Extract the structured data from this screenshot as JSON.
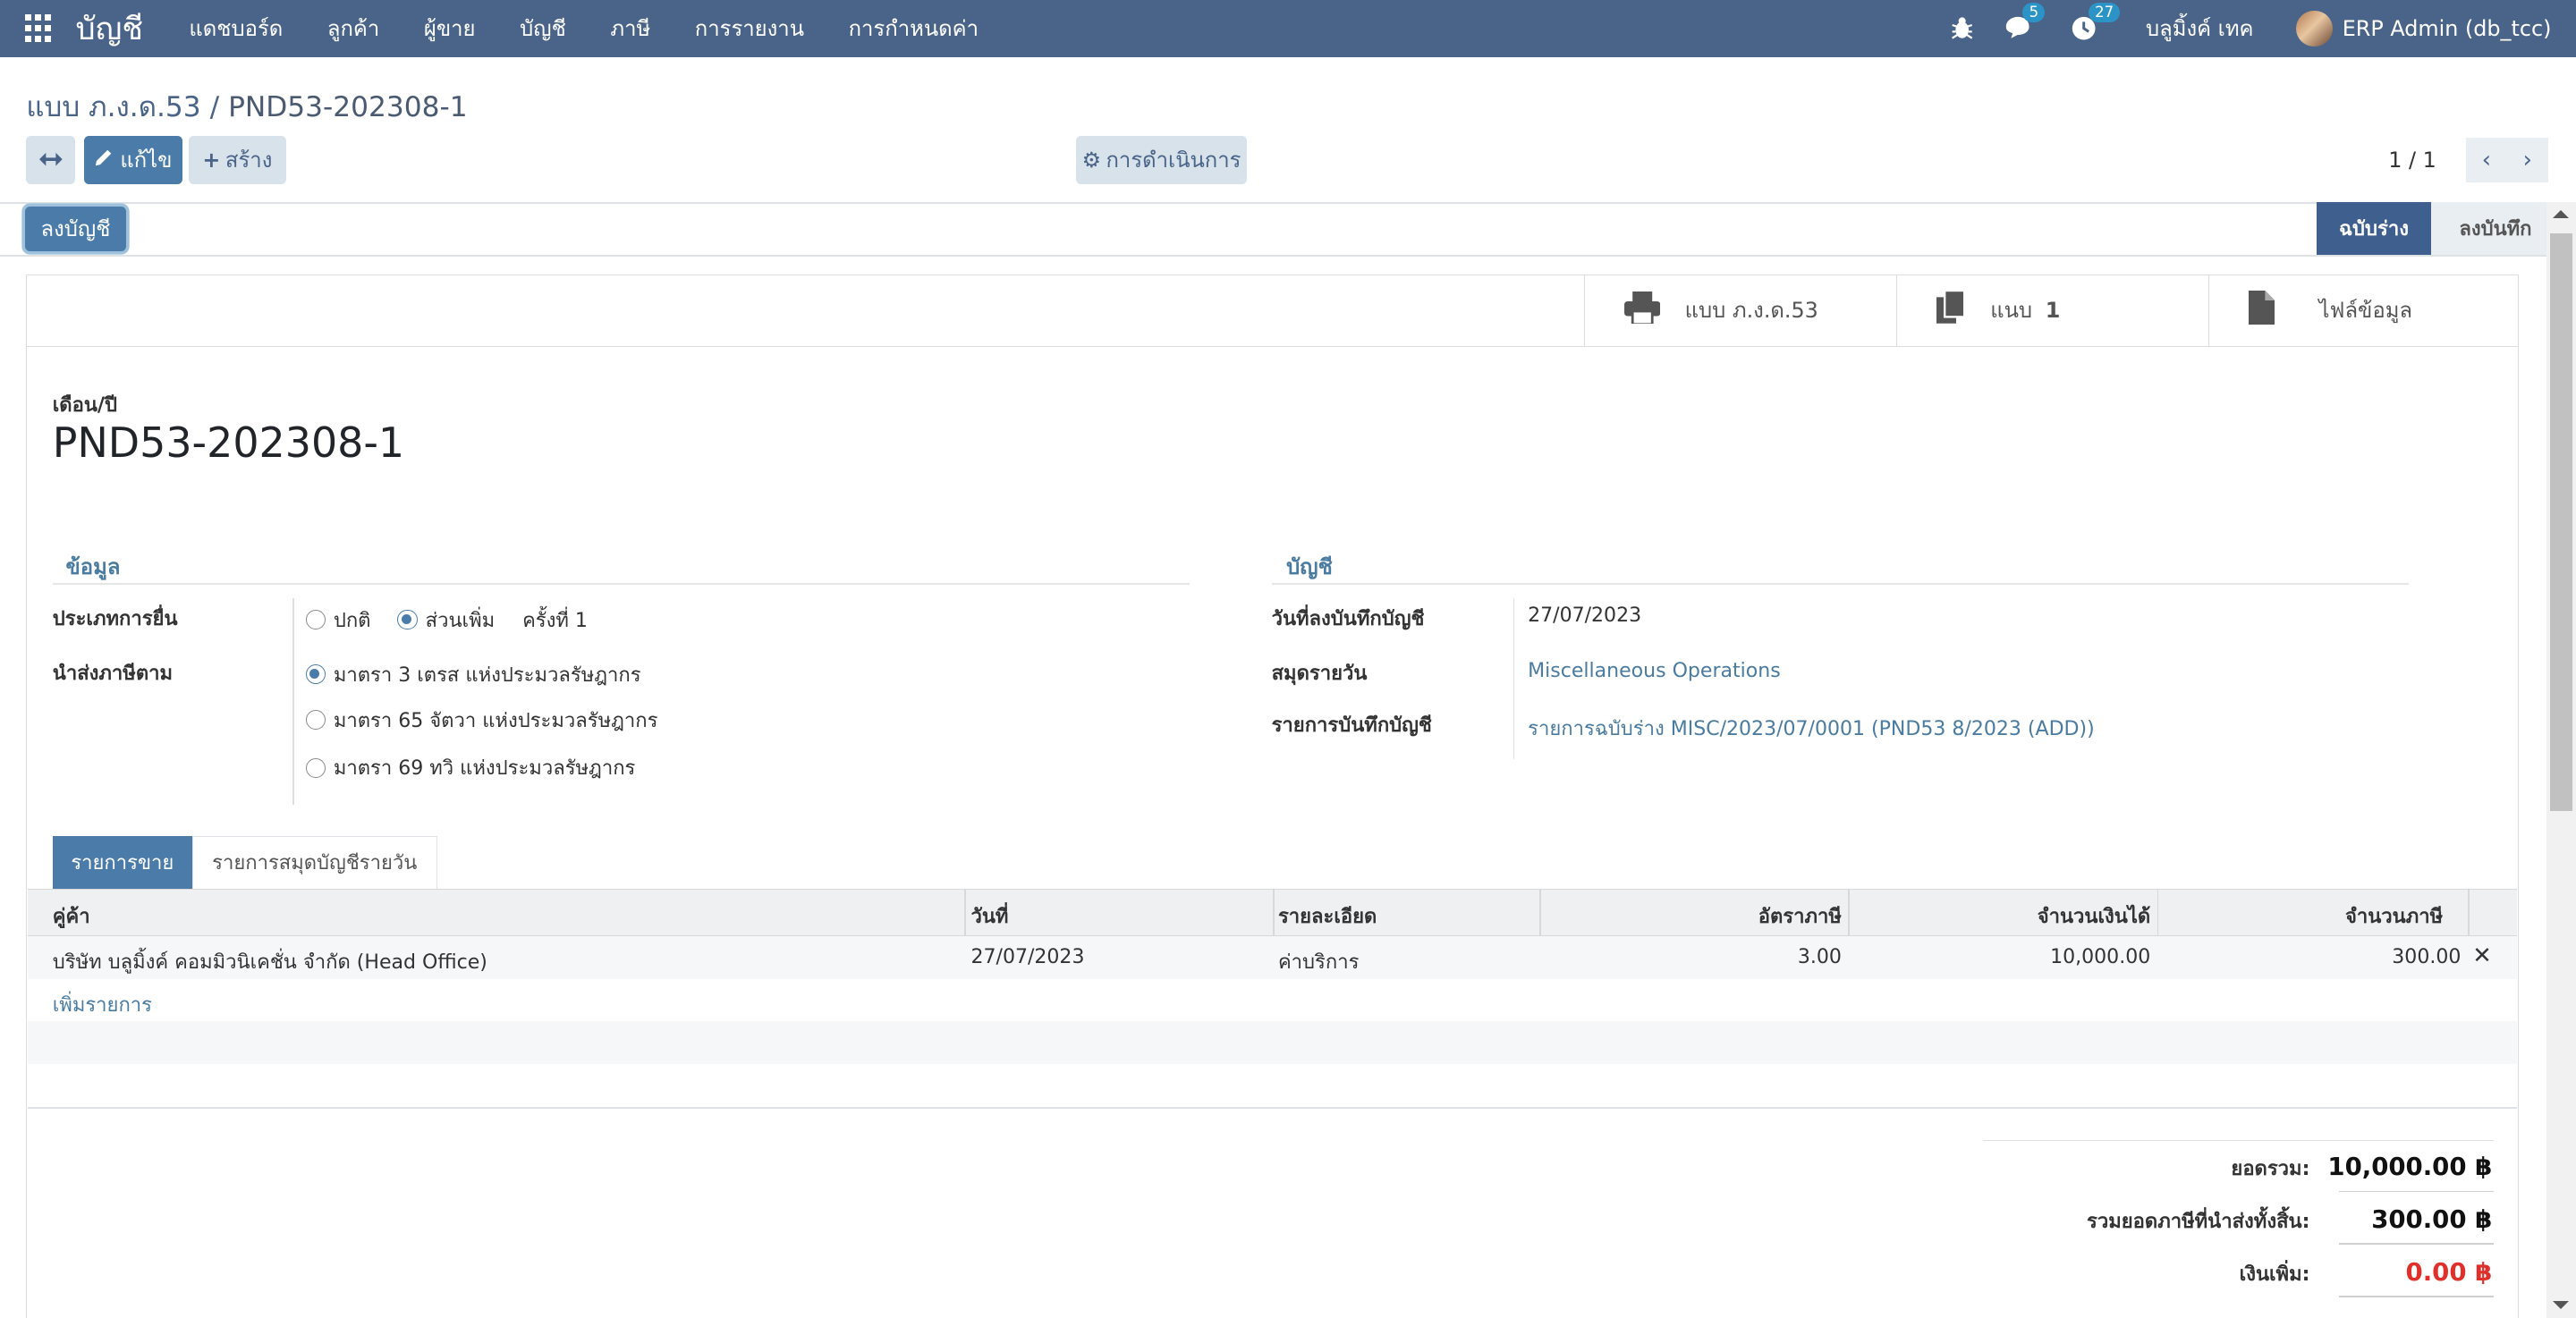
{
  "navbar": {
    "app_name": "บัญชี",
    "menu": [
      "แดชบอร์ด",
      "ลูกค้า",
      "ผู้ขาย",
      "บัญชี",
      "ภาษี",
      "การรายงาน",
      "การกำหนดค่า"
    ],
    "chat_count": "5",
    "activity_count": "27",
    "company": "บลูมิ้งค์ เทค",
    "user": "ERP Admin (db_tcc)"
  },
  "breadcrumb": {
    "parent": "แบบ ภ.ง.ด.53",
    "separator": "/",
    "current": "PND53-202308-1"
  },
  "toolbar": {
    "edit_label": "แก้ไข",
    "create_label": "สร้าง",
    "action_label": "การดำเนินการ",
    "pager": "1 / 1"
  },
  "status": {
    "post_button": "ลงบัญชี",
    "stage_active": "ฉบับร่าง",
    "stage_next": "ลงบันทึก"
  },
  "smart_buttons": {
    "print_form": "แบบ ภ.ง.ด.53",
    "attachment_label": "แนบ",
    "attachment_count": "1",
    "file_label": "ไฟล์ข้อมูล"
  },
  "header": {
    "period_label": "เดือน/ปี",
    "period_value": "PND53-202308-1"
  },
  "info_group": {
    "title": "ข้อมูล",
    "filing_type_label": "ประเภทการยื่น",
    "filing_options": [
      "ปกติ",
      "ส่วนเพิ่ม"
    ],
    "filing_selected": "ส่วนเพิ่ม",
    "filing_round": "ครั้งที่  1",
    "tax_basis_label": "นำส่งภาษีตาม",
    "tax_basis_options": [
      "มาตรา 3 เตรส แห่งประมวลรัษฎากร",
      "มาตรา 65 จัตวา แห่งประมวลรัษฎากร",
      "มาตรา 69 ทวิ แห่งประมวลรัษฎากร"
    ],
    "tax_basis_selected": "มาตรา 3 เตรส แห่งประมวลรัษฎากร"
  },
  "account_group": {
    "title": "บัญชี",
    "date_label": "วันที่ลงบันทึกบัญชี",
    "date_value": "27/07/2023",
    "journal_label": "สมุดรายวัน",
    "journal_value": "Miscellaneous Operations",
    "entry_label": "รายการบันทึกบัญชี",
    "entry_value": "รายการฉบับร่าง MISC/2023/07/0001 (PND53 8/2023 (ADD))"
  },
  "tabs": [
    "รายการขาย",
    "รายการสมุดบัญชีรายวัน"
  ],
  "table": {
    "columns": [
      "คู่ค้า",
      "วันที่",
      "รายละเอียด",
      "อัตราภาษี",
      "จำนวนเงินได้",
      "จำนวนภาษี"
    ],
    "rows": [
      {
        "partner": "บริษัท บลูมิ้งค์ คอมมิวนิเคชั่น จำกัด (Head Office)",
        "date": "27/07/2023",
        "description": "ค่าบริการ",
        "tax_rate": "3.00",
        "income": "10,000.00",
        "tax": "300.00"
      }
    ],
    "add_line": "เพิ่มรายการ"
  },
  "totals": {
    "total_label": "ยอดรวม:",
    "total_value": "10,000.00 ฿",
    "tax_total_label": "รวมยอดภาษีที่นำส่งทั้งสิ้น:",
    "tax_total_value": "300.00 ฿",
    "surcharge_label": "เงินเพิ่ม:",
    "surcharge_value": "0.00 ฿"
  },
  "colors": {
    "navbar": "#4a6489",
    "primary": "#4b7ba8",
    "link": "#4a7ba0",
    "surcharge": "#e0302b"
  }
}
